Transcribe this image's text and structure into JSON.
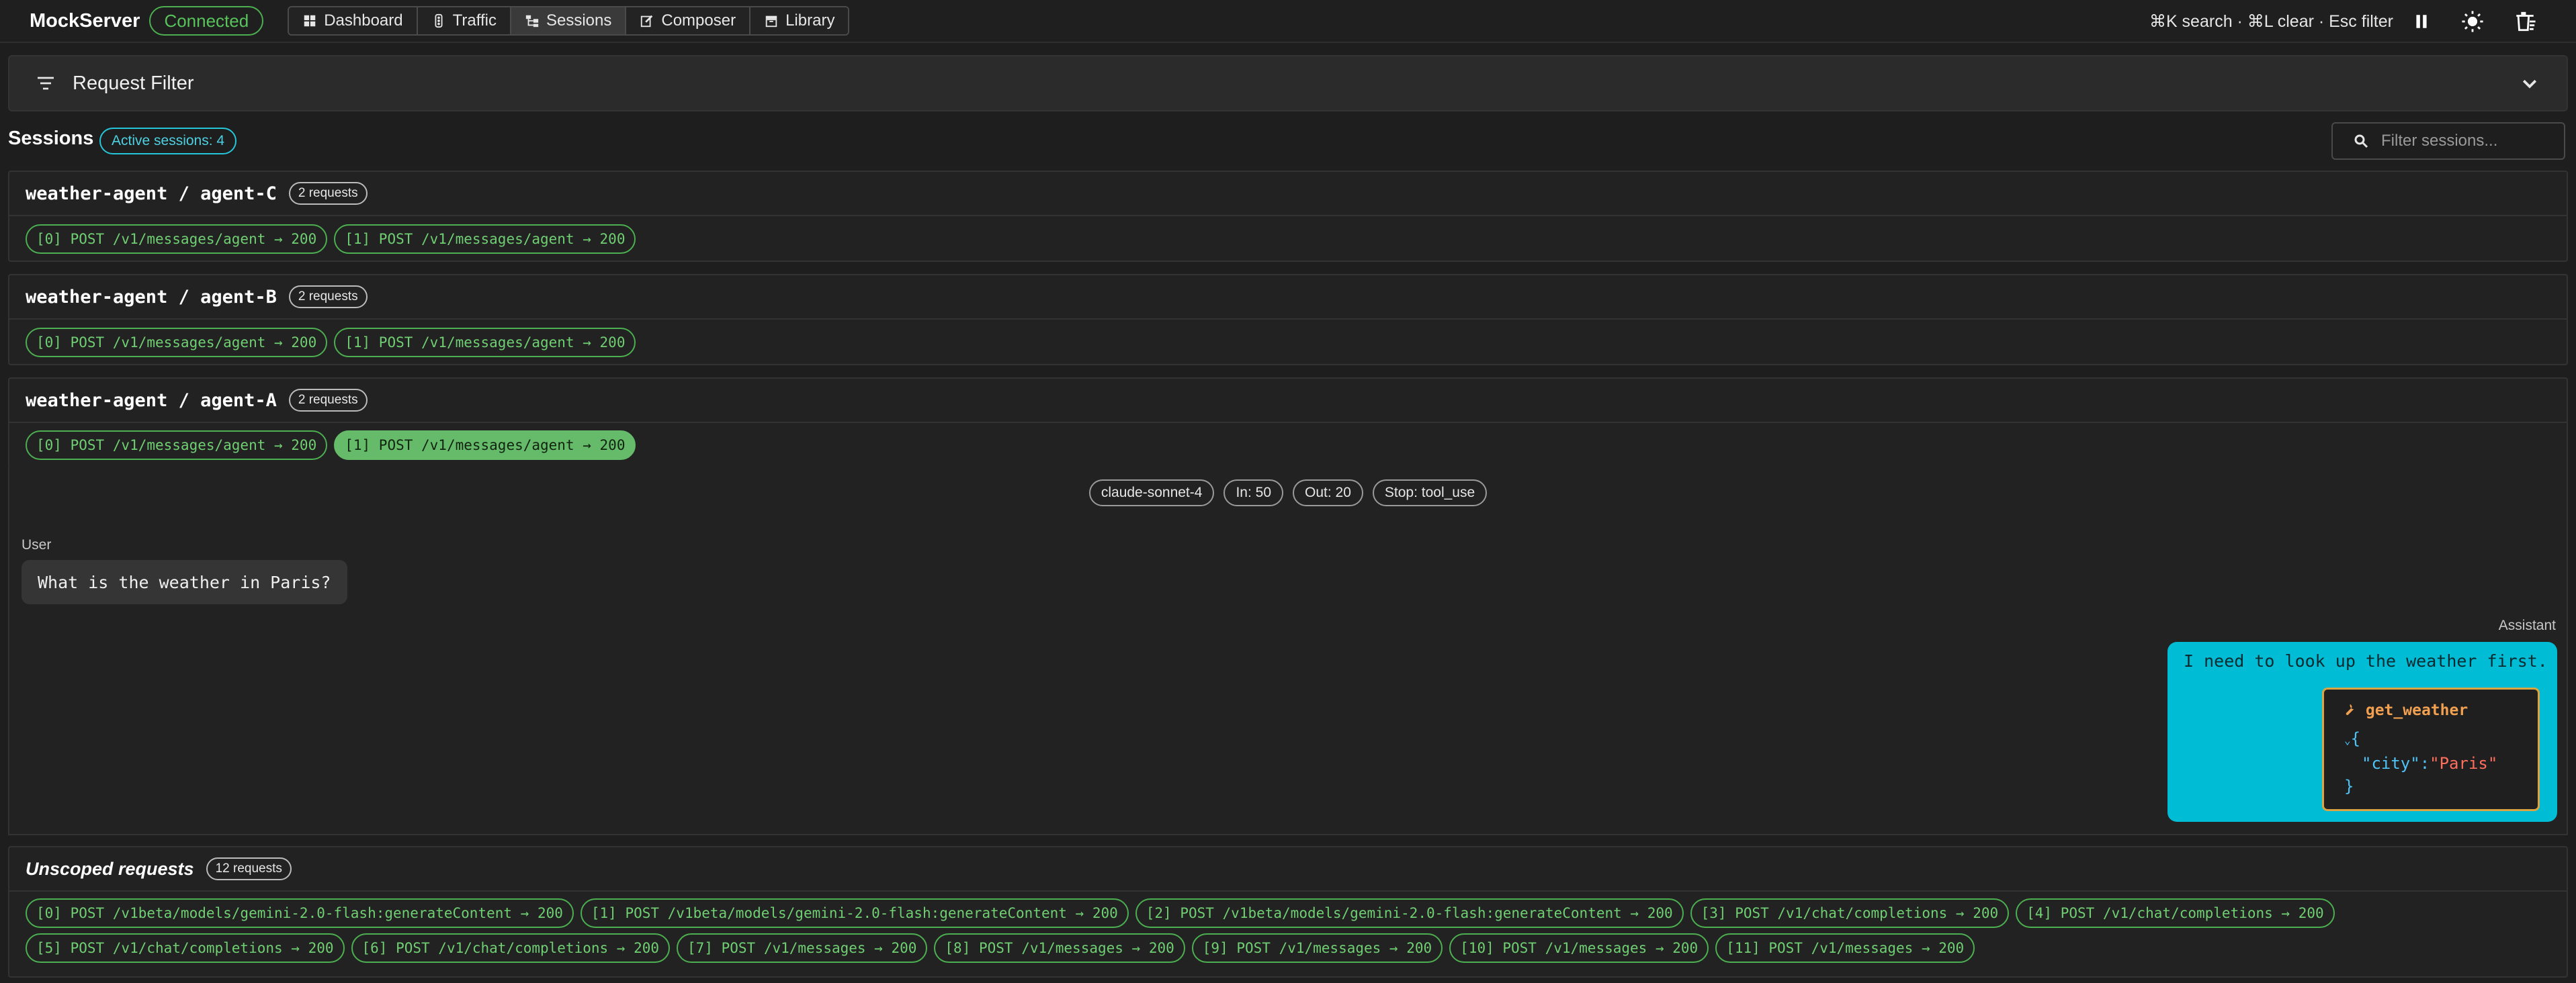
{
  "header": {
    "brand": "MockServer",
    "status": "Connected",
    "nav": [
      {
        "label": "Dashboard",
        "icon": "dashboard-icon"
      },
      {
        "label": "Traffic",
        "icon": "traffic-icon"
      },
      {
        "label": "Sessions",
        "icon": "sessions-icon",
        "active": true
      },
      {
        "label": "Composer",
        "icon": "composer-icon"
      },
      {
        "label": "Library",
        "icon": "library-icon"
      }
    ],
    "shortcuts": "⌘K search · ⌘L clear · Esc filter"
  },
  "filter": {
    "title": "Request Filter"
  },
  "sessions": {
    "title": "Sessions",
    "active_label": "Active sessions: 4",
    "search_placeholder": "Filter sessions...",
    "cards": [
      {
        "title": "weather-agent / agent-C",
        "count": "2 requests",
        "requests": [
          "[0] POST /v1/messages/agent → 200",
          "[1] POST /v1/messages/agent → 200"
        ]
      },
      {
        "title": "weather-agent / agent-B",
        "count": "2 requests",
        "requests": [
          "[0] POST /v1/messages/agent → 200",
          "[1] POST /v1/messages/agent → 200"
        ]
      },
      {
        "title": "weather-agent / agent-A",
        "count": "2 requests",
        "requests": [
          "[0] POST /v1/messages/agent → 200",
          "[1] POST /v1/messages/agent → 200"
        ]
      }
    ]
  },
  "detail": {
    "pills": [
      "claude-sonnet-4",
      "In: 50",
      "Out: 20",
      "Stop: tool_use"
    ],
    "user_role": "User",
    "user_message": "What is the weather in Paris?",
    "assistant_role": "Assistant",
    "assistant_message": "I need to look up the weather first.",
    "tool_name": "get_weather",
    "json_open": "{",
    "json_key": "\"city\"",
    "json_colon": ":",
    "json_value": "\"Paris\"",
    "json_close": "}"
  },
  "unscoped": {
    "title": "Unscoped requests",
    "count": "12 requests",
    "requests": [
      "[0] POST /v1beta/models/gemini-2.0-flash:generateContent → 200",
      "[1] POST /v1beta/models/gemini-2.0-flash:generateContent → 200",
      "[2] POST /v1beta/models/gemini-2.0-flash:generateContent → 200",
      "[3] POST /v1/chat/completions → 200",
      "[4] POST /v1/chat/completions → 200",
      "[5] POST /v1/chat/completions → 200",
      "[6] POST /v1/chat/completions → 200",
      "[7] POST /v1/messages → 200",
      "[8] POST /v1/messages → 200",
      "[9] POST /v1/messages → 200",
      "[10] POST /v1/messages → 200",
      "[11] POST /v1/messages → 200"
    ]
  },
  "colors": {
    "accent": "#00bcd4",
    "success": "#4caf50",
    "tool_border": "#d9a441"
  }
}
